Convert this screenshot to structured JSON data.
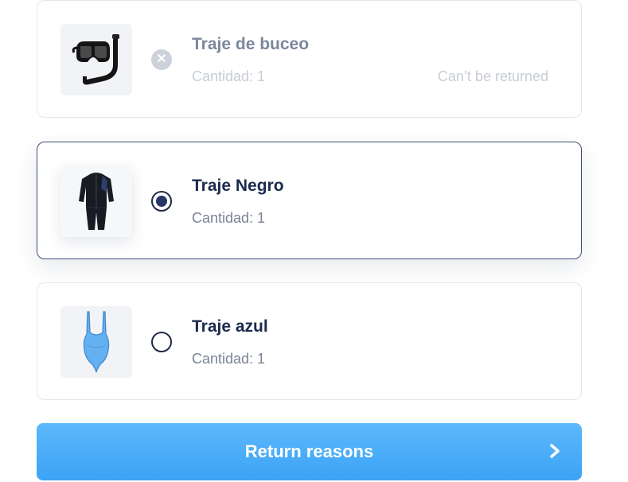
{
  "items": [
    {
      "name": "Traje de buceo",
      "quantity": "Cantidad: 1",
      "note": "Can’t be returned",
      "state": "disabled",
      "icon": "snorkel-mask-icon",
      "radio_glyph": "✕"
    },
    {
      "name": "Traje Negro",
      "quantity": "Cantidad: 1",
      "state": "selected",
      "icon": "black-wetsuit-icon"
    },
    {
      "name": "Traje azul",
      "quantity": "Cantidad: 1",
      "state": "unselected",
      "icon": "blue-swimsuit-icon"
    }
  ],
  "action": {
    "label": "Return reasons",
    "icon": "chevron-right-icon"
  },
  "colors": {
    "accent": "#3ca3f6",
    "text_primary": "#1c2a4e",
    "selected_border": "#3e4e74"
  }
}
